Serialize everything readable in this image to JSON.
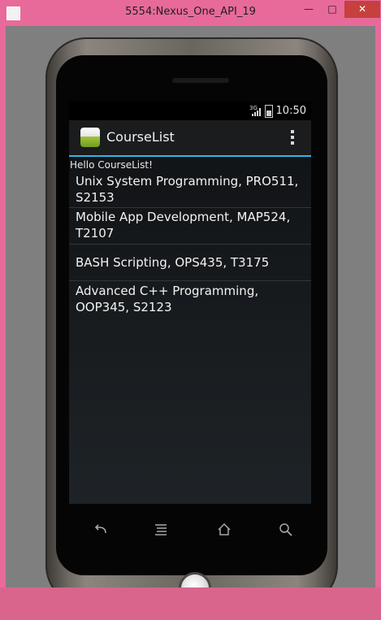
{
  "window": {
    "title": "5554:Nexus_One_API_19",
    "minimize_label": "—",
    "maximize_label": "□",
    "close_label": "✕"
  },
  "status_bar": {
    "time": "10:50",
    "network_label": "3G"
  },
  "action_bar": {
    "title": "CourseList"
  },
  "main": {
    "hello_text": "Hello CourseList!",
    "courses": [
      {
        "line1": "Unix System Programming, PRO511,",
        "line2": "S2153"
      },
      {
        "line1": "Mobile App Development, MAP524,",
        "line2": "T2107"
      },
      {
        "line1": "BASH Scripting, OPS435, T3175",
        "line2": ""
      },
      {
        "line1": "Advanced C++ Programming,",
        "line2": "OOP345, S2123"
      }
    ]
  },
  "nav_bar": {
    "icons": [
      "back-icon",
      "menu-icon",
      "home-icon",
      "search-icon"
    ]
  },
  "colors": {
    "accent": "#33b5e5",
    "window_frame": "#e86a9a",
    "emulator_bg": "#7f7f7f"
  }
}
